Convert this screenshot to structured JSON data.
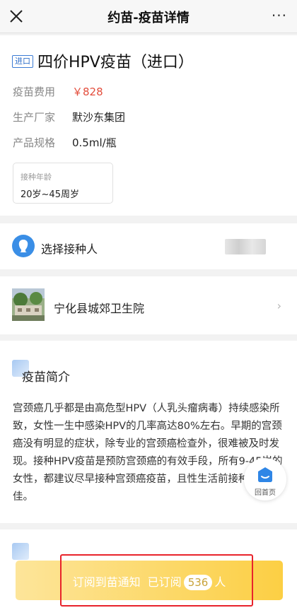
{
  "nav": {
    "title": "约苗-疫苗详情",
    "more": "···"
  },
  "product": {
    "badge": "进口",
    "title": "四价HPV疫苗（进口）",
    "fee_label": "疫苗费用",
    "fee_value": "￥828",
    "maker_label": "生产厂家",
    "maker_value": "默沙东集团",
    "spec_label": "产品规格",
    "spec_value": "0.5ml/瓶",
    "age_label": "接种年龄",
    "age_value": "20岁~45周岁"
  },
  "recipient": {
    "label": "选择接种人"
  },
  "hospital": {
    "name": "宁化县城郊卫生院",
    "chevron": "›"
  },
  "intro": {
    "title": "疫苗简介",
    "text": "宫颈癌几乎都是由高危型HPV（人乳头瘤病毒）持续感染所致，女性一生中感染HPV的几率高达80%左右。早期的宫颈癌没有明显的症状，除专业的宫颈癌检查外，很难被及时发现。接种HPV疫苗是预防宫颈癌的有效手段，所有9-45岁的女性，都建议尽早接种宫颈癌疫苗，且性生活前接种效果最佳。"
  },
  "home_button": {
    "label": "回首页"
  },
  "subscribe": {
    "text": "订阅到苗通知",
    "subscribed_prefix": "已订阅",
    "count": "536",
    "suffix": "人"
  },
  "colors": {
    "accent_blue": "#3a8ee6",
    "price_red": "#e34d3c",
    "button_yellow": "#fccf44",
    "highlight_red": "#e8232b"
  }
}
